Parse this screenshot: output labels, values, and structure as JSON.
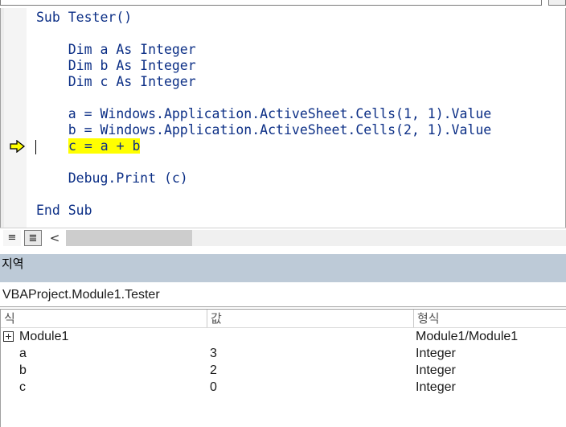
{
  "code_window": {
    "lines": [
      {
        "text": "Sub Tester()"
      },
      {
        "text": ""
      },
      {
        "text": "    Dim a As Integer"
      },
      {
        "text": "    Dim b As Integer"
      },
      {
        "text": "    Dim c As Integer"
      },
      {
        "text": ""
      },
      {
        "text": "    a = Windows.Application.ActiveSheet.Cells(1, 1).Value"
      },
      {
        "text": "    b = Windows.Application.ActiveSheet.Cells(2, 1).Value"
      },
      {
        "text": "c = a + b"
      },
      {
        "text": ""
      },
      {
        "text": "    Debug.Print (c)"
      },
      {
        "text": ""
      },
      {
        "text": "End Sub"
      }
    ],
    "current_line_index": 8,
    "highlight_color": "#ffff00",
    "code_color": "#0c2f86",
    "exec_arrow_color": "#ffff00",
    "bottom_bar": {
      "procedure_view_icon": "procedure-view-icon",
      "full_module_view_icon": "full-module-view-icon",
      "procedure_view_glyph": "≡",
      "full_module_view_glyph": "≣",
      "scroll_left_glyph": "<"
    }
  },
  "locals": {
    "title": "지역",
    "title_bar_color": "#bdcad7",
    "context": "VBAProject.Module1.Tester",
    "columns": [
      "식",
      "값",
      "형식"
    ],
    "rows": [
      {
        "expression": "Module1",
        "value": "",
        "type": "Module1/Module1",
        "expandable": true
      },
      {
        "expression": "a",
        "value": "3",
        "type": "Integer",
        "expandable": false
      },
      {
        "expression": "b",
        "value": "2",
        "type": "Integer",
        "expandable": false
      },
      {
        "expression": "c",
        "value": "0",
        "type": "Integer",
        "expandable": false
      }
    ]
  }
}
